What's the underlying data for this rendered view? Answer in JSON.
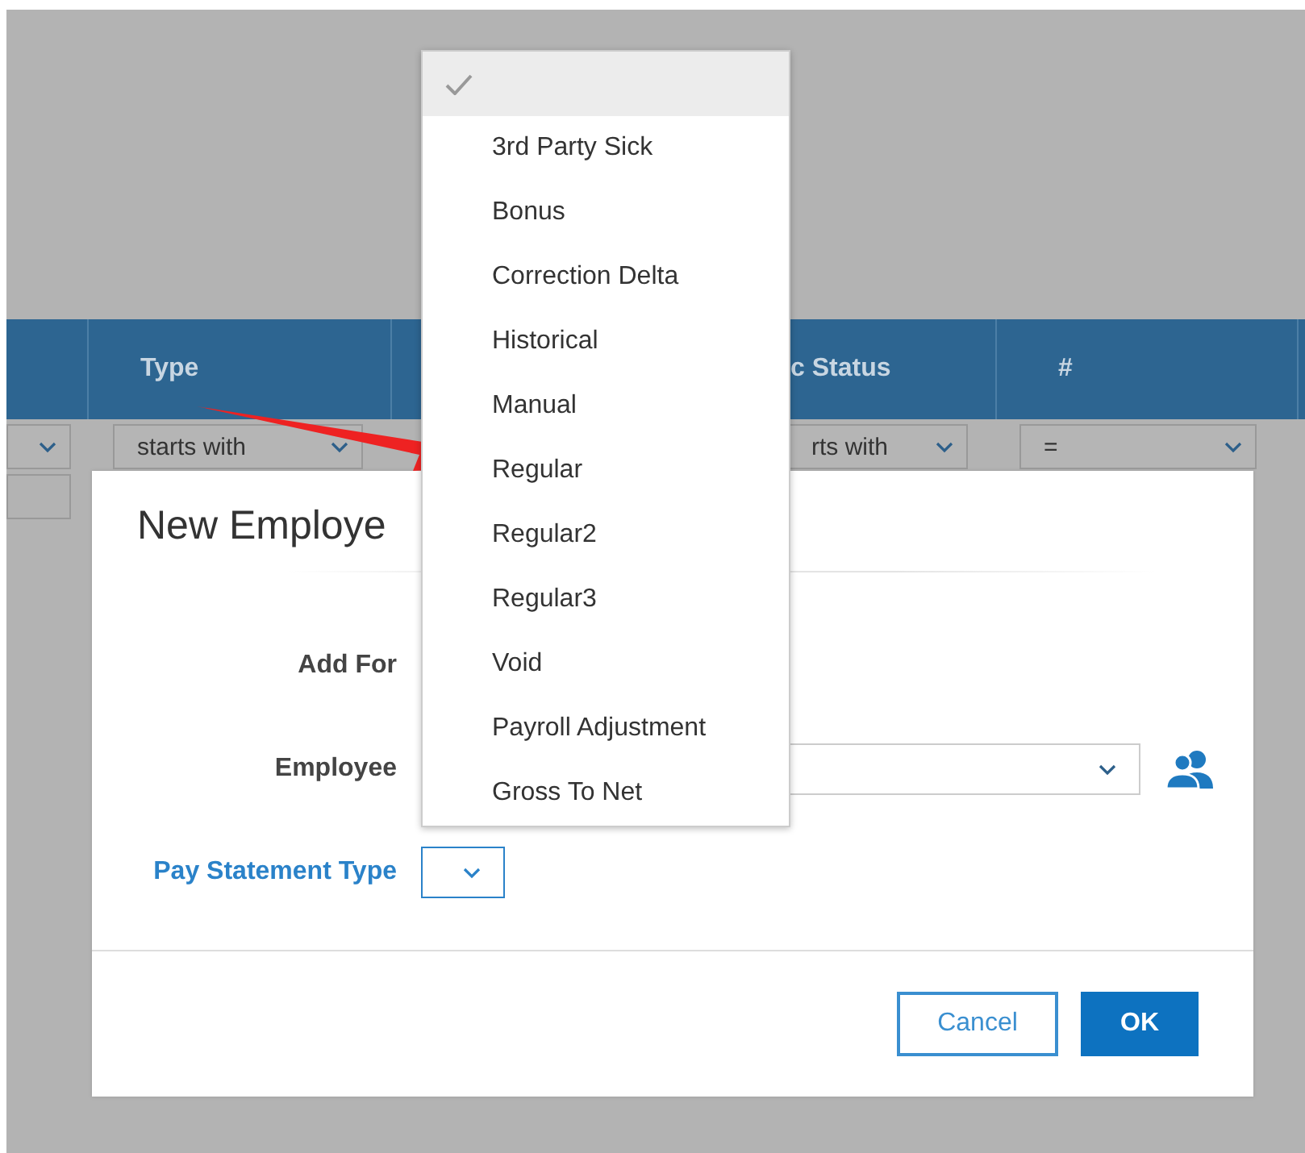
{
  "table": {
    "columns": [
      {},
      {
        "label": "Type"
      },
      {},
      {
        "label": "c Status"
      },
      {
        "label": "#"
      }
    ],
    "filters": [
      {
        "kind": "select"
      },
      {
        "kind": "select",
        "value": "starts with"
      },
      {
        "kind": "hidden"
      },
      {
        "kind": "select",
        "value": "rts with"
      },
      {
        "kind": "select",
        "value": "="
      }
    ]
  },
  "dialog": {
    "title": "New Employe",
    "fields": [
      {
        "label": "Add For",
        "kind": "blank",
        "active": false
      },
      {
        "label": "Employee",
        "kind": "lookup",
        "active": false
      },
      {
        "label": "Pay Statement Type",
        "kind": "small-select",
        "active": true
      }
    ],
    "buttons": [
      {
        "label": "Cancel",
        "kind": "secondary"
      },
      {
        "label": "OK",
        "kind": "primary"
      }
    ]
  },
  "dropdown": {
    "items": [
      {
        "selected": true
      },
      {
        "label": "3rd Party Sick",
        "selected": false
      },
      {
        "label": "Bonus",
        "selected": false
      },
      {
        "label": "Correction Delta",
        "selected": false
      },
      {
        "label": "Historical",
        "selected": false
      },
      {
        "label": "Manual",
        "selected": false
      },
      {
        "label": "Regular",
        "selected": false
      },
      {
        "label": "Regular2",
        "selected": false
      },
      {
        "label": "Regular3",
        "selected": false
      },
      {
        "label": "Void",
        "selected": false
      },
      {
        "label": "Payroll Adjustment",
        "selected": false
      },
      {
        "label": "Gross To Net",
        "selected": false
      }
    ]
  }
}
